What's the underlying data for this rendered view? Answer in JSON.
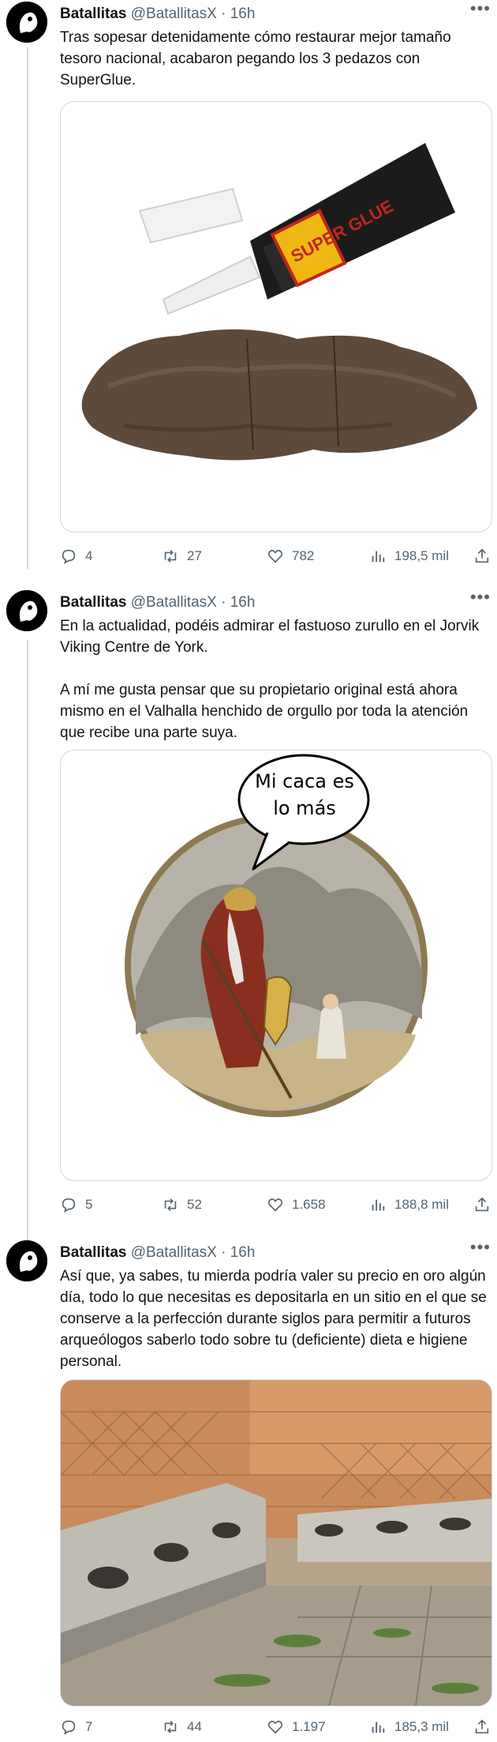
{
  "tweets": [
    {
      "author": "Batallitas",
      "handle": "@BatallitasX",
      "dot": "·",
      "time": "16h",
      "text": "Tras sopesar detenidamente cómo restaurar mejor tamaño tesoro nacional, acabaron pegando los 3 pedazos con SuperGlue.",
      "media": "superglue-tube-and-coprolite",
      "media_text": "SUPER GLUE",
      "stats": {
        "replies": "4",
        "retweets": "27",
        "likes": "782",
        "views": "198,5 mil"
      }
    },
    {
      "author": "Batallitas",
      "handle": "@BatallitasX",
      "dot": "·",
      "time": "16h",
      "text": "En la actualidad, podéis admirar el fastuoso zurullo en el Jorvik Viking Centre de York.\n\nA mí me gusta pensar que su propietario original está ahora mismo en el Valhalla henchido de orgullo por toda la atención que recibe una parte suya.",
      "media": "viking-illustration-with-speech-bubble",
      "speech_bubble": "Mi caca es lo más",
      "stats": {
        "replies": "5",
        "retweets": "52",
        "likes": "1.658",
        "views": "188,8 mil"
      }
    },
    {
      "author": "Batallitas",
      "handle": "@BatallitasX",
      "dot": "·",
      "time": "16h",
      "text": "Así que, ya sabes, tu mierda podría valer su precio en oro algún día, todo lo que necesitas es depositarla en un sitio en el que se conserve a la perfección durante siglos para permitir a futuros arqueólogos saberlo todo sobre tu (deficiente) dieta e higiene personal.",
      "media": "roman-latrines-photo",
      "stats": {
        "replies": "7",
        "retweets": "44",
        "likes": "1.197",
        "views": "185,3 mil"
      }
    }
  ],
  "icons": {
    "more": "more-icon",
    "reply": "reply-icon",
    "retweet": "retweet-icon",
    "like": "like-icon",
    "views": "views-icon",
    "share": "share-icon"
  },
  "colors": {
    "text": "#0f1419",
    "secondary": "#536471",
    "border": "#cfd9de"
  }
}
